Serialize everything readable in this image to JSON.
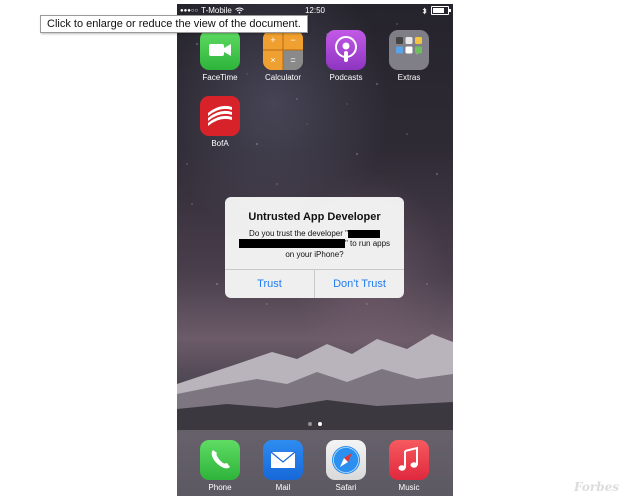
{
  "tooltip": {
    "text": "Click to enlarge or reduce the view of the document."
  },
  "status_bar": {
    "signal": "●●●○○",
    "carrier": "T-Mobile",
    "time": "12:50",
    "bluetooth_icon": "bluetooth-icon",
    "battery_level": 0.75
  },
  "apps": [
    {
      "label": "FaceTime",
      "icon": "facetime-icon"
    },
    {
      "label": "Calculator",
      "icon": "calculator-icon"
    },
    {
      "label": "Podcasts",
      "icon": "podcasts-icon"
    },
    {
      "label": "Extras",
      "icon": "folder-icon"
    },
    {
      "label": "BofA",
      "icon": "bofa-icon"
    }
  ],
  "dock": [
    {
      "label": "Phone",
      "icon": "phone-icon"
    },
    {
      "label": "Mail",
      "icon": "mail-icon"
    },
    {
      "label": "Safari",
      "icon": "safari-icon"
    },
    {
      "label": "Music",
      "icon": "music-icon"
    }
  ],
  "alert": {
    "title": "Untrusted App Developer",
    "line1": "Do you trust the developer \"",
    "line2": "\" to run apps",
    "line3": "on your iPhone?",
    "trust_label": "Trust",
    "dont_trust_label": "Don't Trust"
  },
  "page_dots": {
    "count": 2,
    "active": 2
  },
  "watermark": {
    "text": "Forbes"
  },
  "colors": {
    "alert_button": "#1f7cf2",
    "facetime": "#2eb43a",
    "podcasts": "#8e35c2",
    "bofa": "#d8222a"
  }
}
